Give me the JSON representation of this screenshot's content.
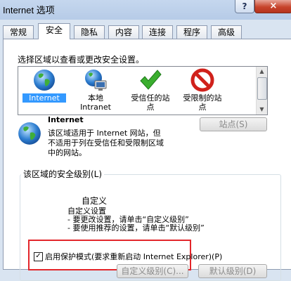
{
  "window": {
    "title": "Internet 选项",
    "help_label": "?",
    "close_label": "×"
  },
  "tabs": [
    "常规",
    "安全",
    "隐私",
    "内容",
    "连接",
    "程序",
    "高级"
  ],
  "active_tab": "安全",
  "zone_prompt": "选择区域以查看或更改安全设置。",
  "zones": [
    {
      "label": "Internet",
      "icon": "globe-icon",
      "selected": true
    },
    {
      "label": "本地",
      "label2": "Intranet",
      "icon": "local-intranet-icon",
      "selected": false
    },
    {
      "label": "受信任的站",
      "label2": "点",
      "icon": "checkmark-icon",
      "selected": false
    },
    {
      "label": "受限制的站",
      "label2": "点",
      "icon": "no-entry-icon",
      "selected": false
    }
  ],
  "zone_info": {
    "title": "Internet",
    "desc_lines": [
      "该区域适用于 Internet 网站，但",
      "不适用于列在受信任和受限制区域",
      "中的网站。"
    ],
    "sites_button": "站点(S)"
  },
  "security_level": {
    "group_label": "该区域的安全级别(L)",
    "level_name": "自定义",
    "lines": [
      "自定义设置",
      "- 要更改设置，请单击“自定义级别”",
      "- 要使用推荐的设置，请单击“默认级别”"
    ]
  },
  "protected_mode": {
    "label": "启用保护模式(要求重新启动 Internet Explorer)(P)",
    "checked": true
  },
  "bottom_buttons": [
    "自定义级别(C)...",
    "默认级别(D)"
  ],
  "colors": {
    "accent_selection": "#3399ff",
    "highlight_box": "#e3262b",
    "close_button": "#c7442c"
  }
}
